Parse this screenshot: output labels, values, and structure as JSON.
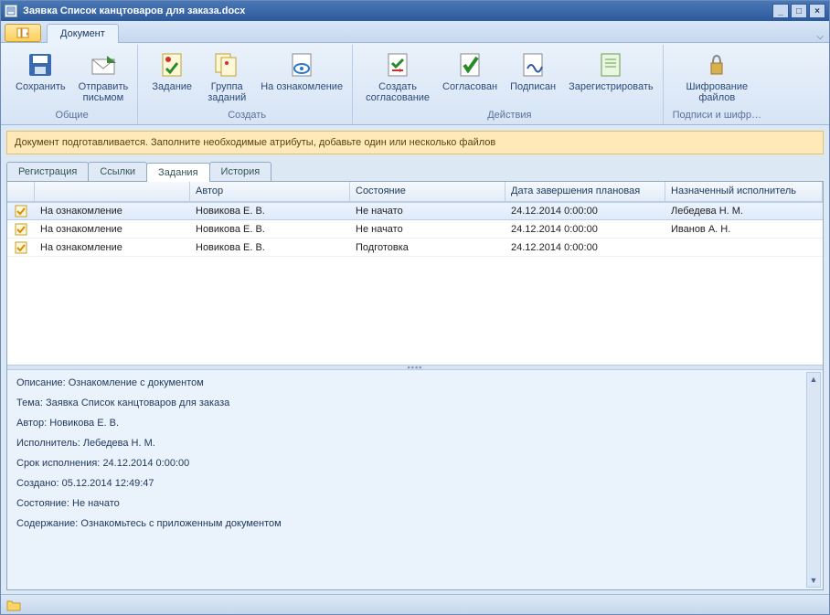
{
  "title": "Заявка Список канцтоваров для заказа.docx",
  "ribbonTab": "Документ",
  "ribbon": {
    "groups": [
      {
        "title": "Общие",
        "items": [
          {
            "key": "save",
            "label": "Сохранить"
          },
          {
            "key": "send",
            "label": "Отправить\nписьмом"
          }
        ]
      },
      {
        "title": "Создать",
        "items": [
          {
            "key": "task",
            "label": "Задание"
          },
          {
            "key": "taskgroup",
            "label": "Группа\nзаданий"
          },
          {
            "key": "review",
            "label": "На ознакомление"
          }
        ]
      },
      {
        "title": "Действия",
        "items": [
          {
            "key": "approve",
            "label": "Создать\nсогласование"
          },
          {
            "key": "approved",
            "label": "Согласован"
          },
          {
            "key": "signed",
            "label": "Подписан"
          },
          {
            "key": "register",
            "label": "Зарегистрировать"
          }
        ]
      },
      {
        "title": "Подписи и шифр…",
        "items": [
          {
            "key": "encrypt",
            "label": "Шифрование\nфайлов"
          }
        ]
      }
    ]
  },
  "infobar": "Документ подготавливается. Заполните необходимые атрибуты, добавьте один или несколько файлов",
  "tabs": [
    "Регистрация",
    "Ссылки",
    "Задания",
    "История"
  ],
  "activeTab": 2,
  "columns": [
    "",
    "Автор",
    "Состояние",
    "Дата завершения плановая",
    "Назначенный исполнитель"
  ],
  "rows": [
    {
      "name": "На ознакомление",
      "author": "Новикова Е. В.",
      "state": "Не начато",
      "date": "24.12.2014 0:00:00",
      "assignee": "Лебедева Н. М.",
      "selected": true
    },
    {
      "name": "На ознакомление",
      "author": "Новикова Е. В.",
      "state": "Не начато",
      "date": "24.12.2014 0:00:00",
      "assignee": "Иванов А. Н.",
      "selected": false
    },
    {
      "name": "На ознакомление",
      "author": "Новикова Е. В.",
      "state": "Подготовка",
      "date": "24.12.2014 0:00:00",
      "assignee": "",
      "selected": false
    }
  ],
  "details": {
    "description_label": "Описание:",
    "description": "Ознакомление с документом",
    "topic_label": "Тема:",
    "topic": "Заявка  Список канцтоваров для заказа",
    "author_label": "Автор:",
    "author": "Новикова Е. В.",
    "assignee_label": "Исполнитель:",
    "assignee": "Лебедева Н. М.",
    "deadline_label": "Срок исполнения:",
    "deadline": "24.12.2014 0:00:00",
    "created_label": "Создано:",
    "created": "05.12.2014 12:49:47",
    "state_label": "Состояние:",
    "state": "Не начато",
    "content_label": "Содержание:",
    "content": "Ознакомьтесь с приложенным документом"
  }
}
